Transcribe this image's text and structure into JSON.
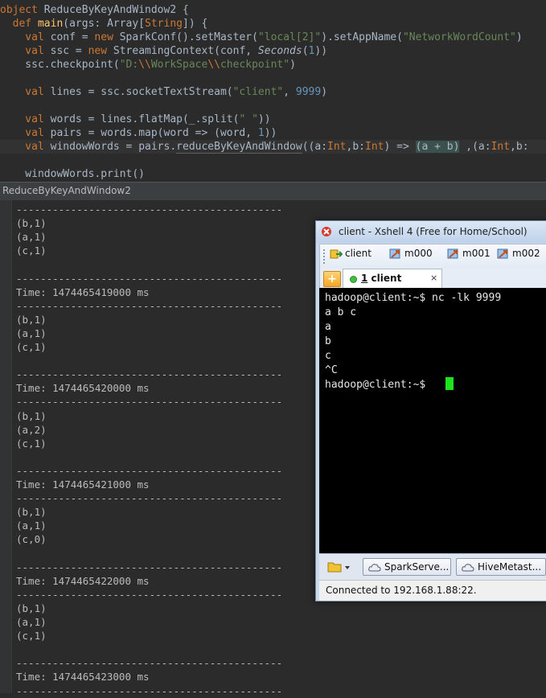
{
  "editor": {
    "lines": [
      {
        "parts": [
          [
            "kw",
            "object "
          ],
          [
            "",
            "ReduceByKeyAndWindow2 {"
          ]
        ]
      },
      {
        "parts": [
          [
            "kw",
            "  def "
          ],
          [
            "fn",
            "main"
          ],
          [
            "",
            "(args: Array["
          ],
          [
            "kw",
            "String"
          ],
          [
            "",
            "]) {"
          ]
        ]
      },
      {
        "parts": [
          [
            "kw",
            "    val "
          ],
          [
            "",
            "conf = "
          ],
          [
            "kw",
            "new "
          ],
          [
            "",
            "SparkConf().setMaster("
          ],
          [
            "str",
            "\"local[2]\""
          ],
          [
            "",
            ").setAppName("
          ],
          [
            "str",
            "\"NetworkWordCount\""
          ],
          [
            "",
            ")"
          ]
        ]
      },
      {
        "parts": [
          [
            "kw",
            "    val "
          ],
          [
            "",
            "ssc = "
          ],
          [
            "kw",
            "new "
          ],
          [
            "",
            "StreamingContext(conf, "
          ],
          [
            "it",
            "Seconds"
          ],
          [
            "",
            "("
          ],
          [
            "num",
            "1"
          ],
          [
            "",
            "))"
          ]
        ]
      },
      {
        "parts": [
          [
            "",
            "    ssc.checkpoint("
          ],
          [
            "str",
            "\"D:"
          ],
          [
            "kw",
            "\\\\"
          ],
          [
            "str",
            "WorkSpace"
          ],
          [
            "kw",
            "\\\\"
          ],
          [
            "str",
            "checkpoint\""
          ],
          [
            "",
            ")"
          ]
        ]
      },
      {
        "parts": [
          [
            "",
            ""
          ]
        ]
      },
      {
        "parts": [
          [
            "kw",
            "    val "
          ],
          [
            "",
            "lines = ssc.socketTextStream("
          ],
          [
            "str",
            "\"client\""
          ],
          [
            "",
            ", "
          ],
          [
            "num",
            "9999"
          ],
          [
            "",
            ")"
          ]
        ]
      },
      {
        "parts": [
          [
            "",
            ""
          ]
        ]
      },
      {
        "parts": [
          [
            "kw",
            "    val "
          ],
          [
            "",
            "words = lines.flatMap(_.split("
          ],
          [
            "str",
            "\" \""
          ],
          [
            "",
            "))"
          ]
        ]
      },
      {
        "parts": [
          [
            "kw",
            "    val "
          ],
          [
            "",
            "pairs = words.map(word => (word, "
          ],
          [
            "num",
            "1"
          ],
          [
            "",
            "))"
          ]
        ]
      },
      {
        "parts": [
          [
            "kw",
            "    val "
          ],
          [
            "",
            "windowWords = pairs."
          ],
          [
            "ul",
            "reduceByKeyAndWindow"
          ],
          [
            "",
            "((a:"
          ],
          [
            "kw",
            "Int"
          ],
          [
            "",
            ",b:"
          ],
          [
            "kw",
            "Int"
          ],
          [
            "",
            ") => "
          ],
          [
            "match",
            "(a + b)"
          ],
          [
            "",
            " ,(a:"
          ],
          [
            "kw",
            "Int"
          ],
          [
            "",
            ",b:"
          ]
        ]
      },
      {
        "parts": [
          [
            "",
            ""
          ]
        ]
      },
      {
        "parts": [
          [
            "",
            "    windowWords.print()"
          ]
        ]
      }
    ]
  },
  "run_tab": {
    "label": "ReduceByKeyAndWindow2"
  },
  "console": {
    "lines": [
      "--------------------------------------------",
      "(b,1)",
      "(a,1)",
      "(c,1)",
      "",
      "--------------------------------------------",
      "Time: 1474465419000 ms",
      "--------------------------------------------",
      "(b,1)",
      "(a,1)",
      "(c,1)",
      "",
      "--------------------------------------------",
      "Time: 1474465420000 ms",
      "--------------------------------------------",
      "(b,1)",
      "(a,2)",
      "(c,1)",
      "",
      "--------------------------------------------",
      "Time: 1474465421000 ms",
      "--------------------------------------------",
      "(b,1)",
      "(a,1)",
      "(c,0)",
      "",
      "--------------------------------------------",
      "Time: 1474465422000 ms",
      "--------------------------------------------",
      "(b,1)",
      "(a,1)",
      "(c,1)",
      "",
      "--------------------------------------------",
      "Time: 1474465423000 ms",
      "--------------------------------------------"
    ]
  },
  "xshell": {
    "title": "client - Xshell 4 (Free for Home/School)",
    "sessions": [
      "client",
      "m000",
      "m001",
      "m002"
    ],
    "tab": {
      "number": "1",
      "label": "client",
      "close": "×"
    },
    "tab_add": "+",
    "terminal_lines": [
      "hadoop@client:~$ nc -lk 9999",
      "a b c",
      "a",
      "b",
      "c",
      "^C",
      "hadoop@client:~$ "
    ],
    "bottom_buttons": [
      "SparkServe...",
      "HiveMetast..."
    ],
    "status": "Connected to 192.168.1.88:22."
  },
  "colors": {
    "cursor": "#1ee21e",
    "keyword": "#cc7832",
    "string": "#6a8759",
    "number": "#6897bb"
  }
}
